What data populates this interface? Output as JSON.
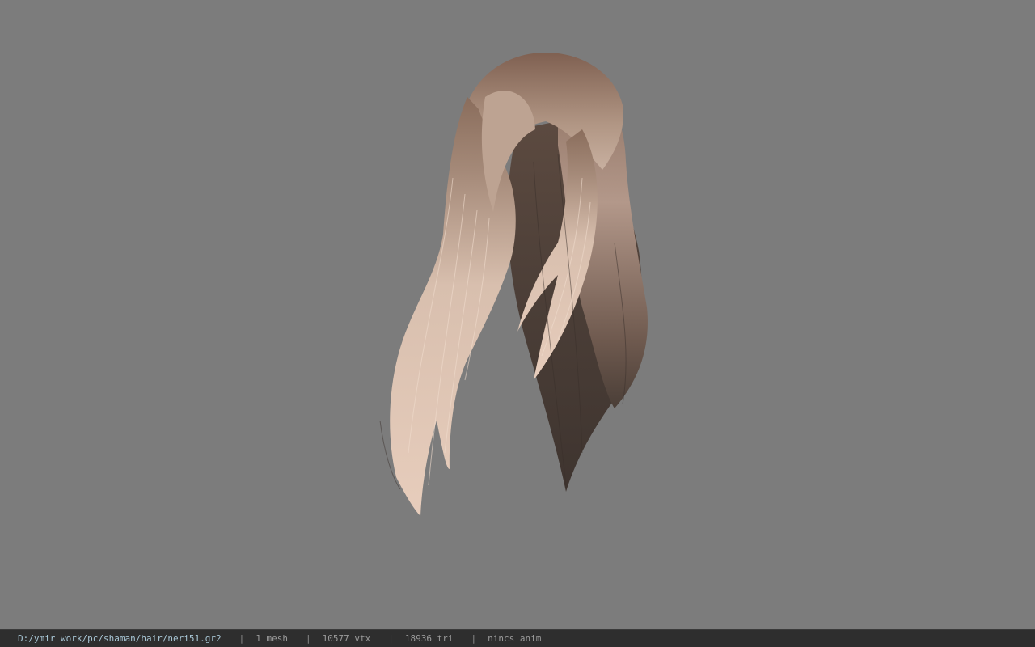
{
  "viewer": {
    "background_color": "#7c7c7c",
    "model_subject": "long layered hair mesh, light blonde to dark brown gradient"
  },
  "status_bar": {
    "file_path": "D:/ymir work/pc/shaman/hair/neri51.gr2",
    "separator": "|",
    "mesh_count": "1 mesh",
    "vertex_count": "10577 vtx",
    "triangle_count": "18936 tri",
    "anim_status": "nincs anim"
  }
}
